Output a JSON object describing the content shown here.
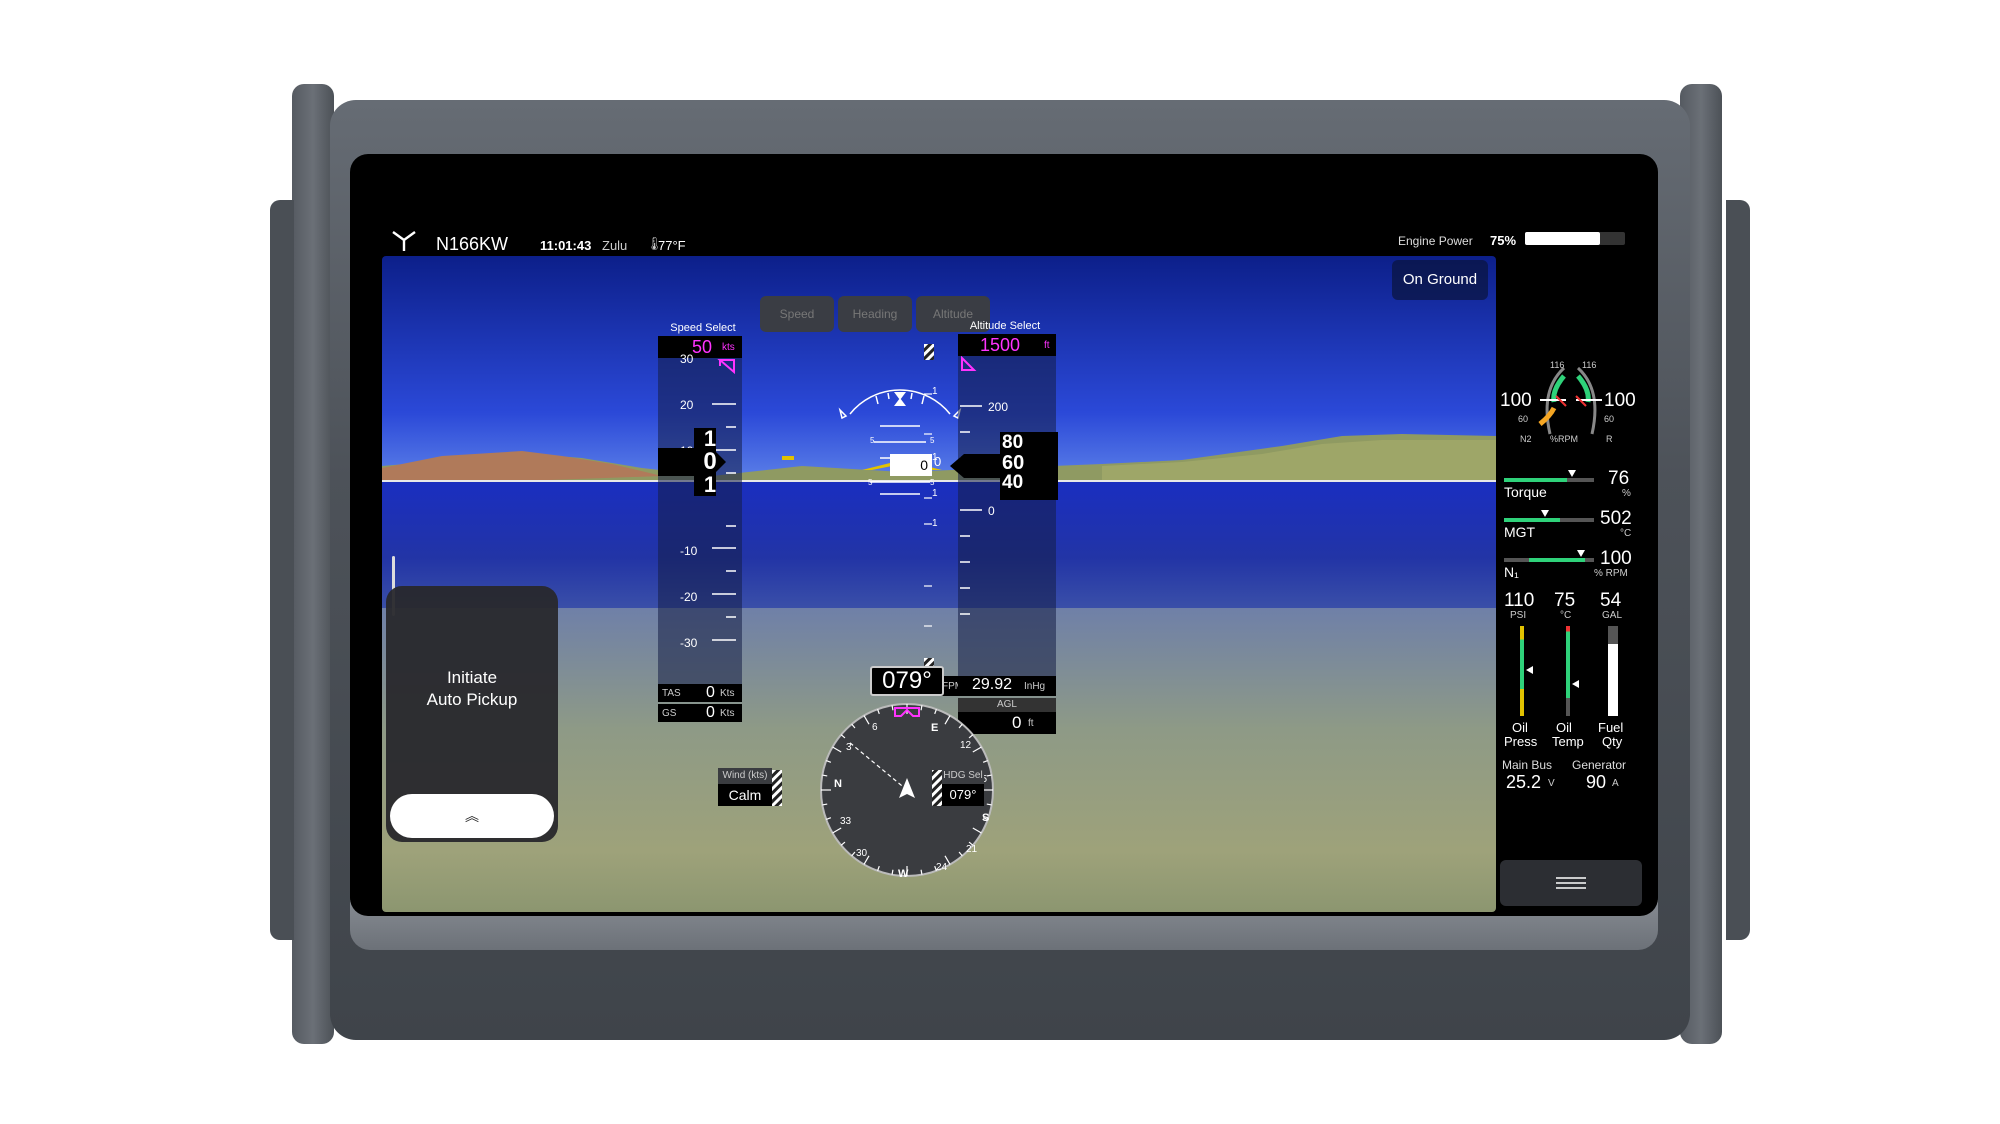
{
  "header": {
    "tail_number": "N166KW",
    "time": "11:01:43",
    "time_zone": "Zulu",
    "temperature": "77°F",
    "engine_power_label": "Engine Power",
    "engine_power_value": "75%",
    "engine_power_fraction": 0.75
  },
  "status": {
    "on_ground": "On Ground"
  },
  "mode_buttons": [
    "Speed",
    "Heading",
    "Altitude"
  ],
  "speed": {
    "select_label": "Speed Select",
    "select_value": "50",
    "select_unit": "kts",
    "tape_ticks": [
      "30",
      "20",
      "10",
      "-10",
      "-20",
      "-30"
    ],
    "current_digits": [
      "1",
      "0",
      "1"
    ],
    "tas_label": "TAS",
    "tas_value": "0",
    "tas_unit": "Kts",
    "gs_label": "GS",
    "gs_value": "0",
    "gs_unit": "Kts"
  },
  "attitude": {
    "pitch_marks": [
      "5",
      "5",
      "5",
      "5"
    ]
  },
  "vsi": {
    "ticks": [
      "1",
      "1",
      "1",
      "1"
    ],
    "pointer": "0",
    "value": "0",
    "unit": "FPM"
  },
  "altitude": {
    "select_label": "Altitude Select",
    "select_value": "1500",
    "select_unit": "ft",
    "tape_ticks": [
      "200",
      "0"
    ],
    "current_digits": [
      "80",
      "60",
      "40"
    ],
    "zero_label": "0",
    "baro_value": "29.92",
    "baro_unit": "InHg",
    "agl_label": "AGL",
    "agl_value": "0",
    "agl_unit": "ft"
  },
  "heading": {
    "value": "079°",
    "card_labels": [
      "E",
      "12",
      "15",
      "S",
      "21",
      "24",
      "W",
      "30",
      "33",
      "N",
      "3",
      "6"
    ],
    "wind_label": "Wind (kts)",
    "wind_value": "Calm",
    "hdg_sel_label": "HDG Sel",
    "hdg_sel_value": "079°"
  },
  "pickup": {
    "label_line1": "Initiate",
    "label_line2": "Auto Pickup",
    "expand_glyph": "︽"
  },
  "engine": {
    "rpm_gauge": {
      "n2_left": "100",
      "r_right": "100",
      "top_left": "116",
      "top_right": "116",
      "low_left": "60",
      "low_right": "60",
      "n2_label": "N2",
      "unit_label": "%RPM",
      "r_label": "R"
    },
    "torque": {
      "label": "Torque",
      "value": "76",
      "unit": "%",
      "fraction": 0.76
    },
    "mgt": {
      "label": "MGT",
      "value": "502",
      "unit": "°C",
      "fraction": 0.45
    },
    "n1": {
      "label": "N₁",
      "value": "100",
      "unit": "% RPM",
      "fraction": 0.85
    },
    "oil_press": {
      "value": "110",
      "unit": "PSI",
      "label1": "Oil",
      "label2": "Press",
      "fraction": 0.6
    },
    "oil_temp": {
      "value": "75",
      "unit": "°C",
      "label1": "Oil",
      "label2": "Temp",
      "fraction": 0.45
    },
    "fuel": {
      "value": "54",
      "unit": "GAL",
      "label1": "Fuel",
      "label2": "Qty",
      "fraction": 0.8
    },
    "main_bus": {
      "label": "Main Bus",
      "value": "25.2",
      "unit": "V"
    },
    "generator": {
      "label": "Generator",
      "value": "90",
      "unit": "A"
    }
  },
  "colors": {
    "magenta": "#ff33ff",
    "green": "#2fd27a",
    "sky": "#1f2fb8",
    "water": "#1f2fa8",
    "ground": "#9aa27a"
  }
}
